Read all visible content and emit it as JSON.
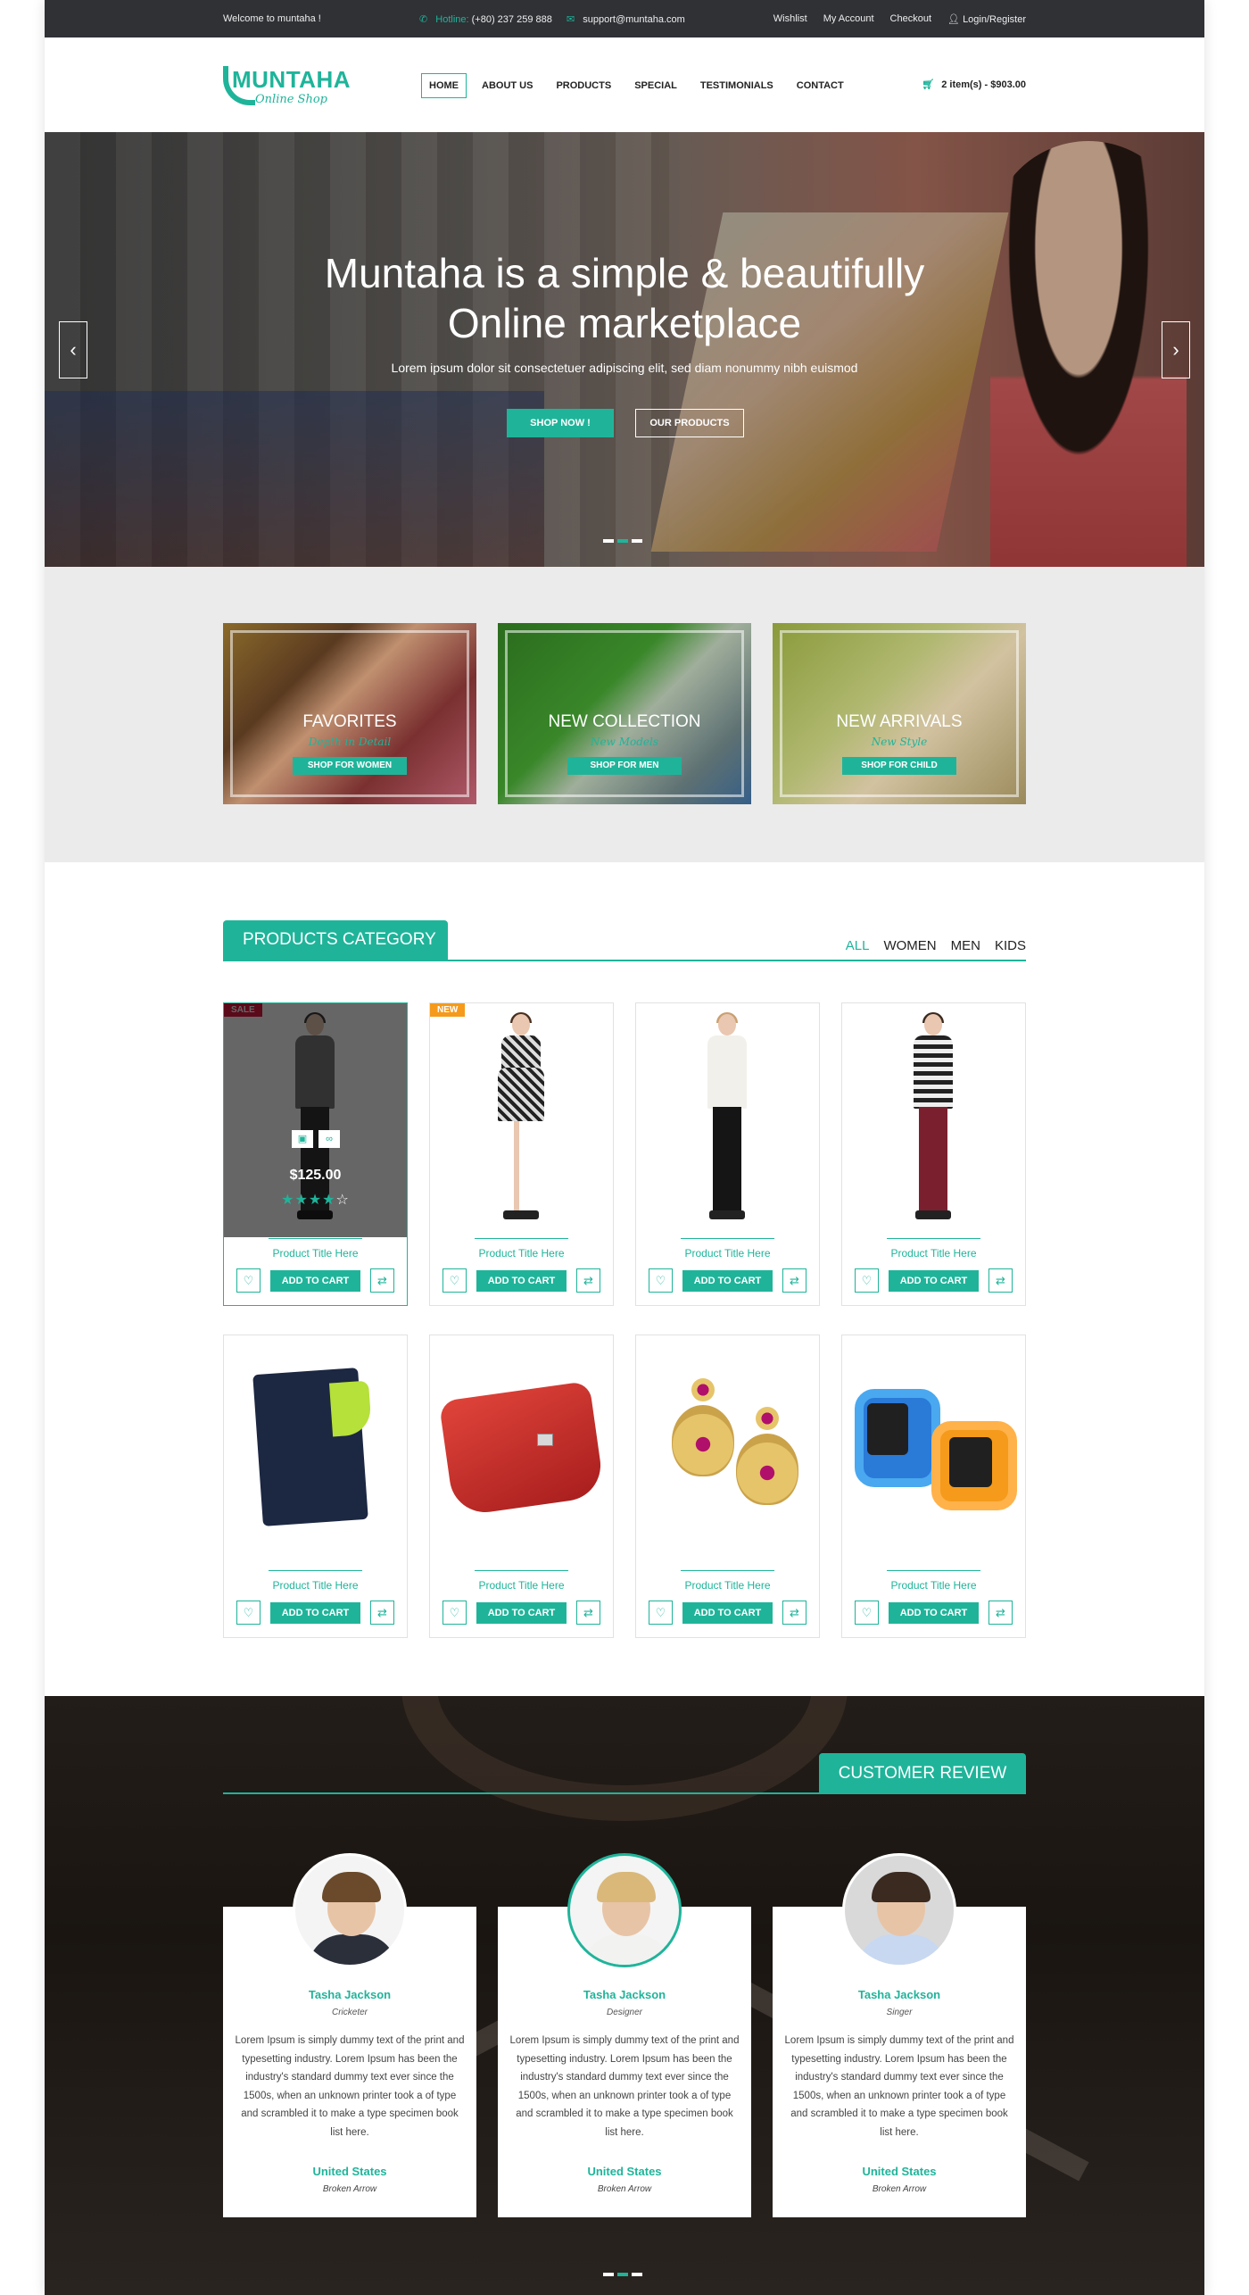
{
  "topbar": {
    "welcome": "Welcome to muntaha !",
    "hotline_label": "Hotline:",
    "hotline_number": "(+80) 237 259 888",
    "email": "support@muntaha.com",
    "links": [
      "Wishlist",
      "My Account",
      "Checkout",
      "Login/Register"
    ]
  },
  "header": {
    "logo_name": "MUNTAHA",
    "logo_tagline": "Online Shop",
    "nav": [
      "HOME",
      "ABOUT US",
      "PRODUCTS",
      "SPECIAL",
      "TESTIMONIALS",
      "CONTACT"
    ],
    "active_nav": "HOME",
    "cart_text": "2 item(s) - $903.00"
  },
  "hero": {
    "title_line1": "Muntaha is a simple & beautifully",
    "title_line2": "Online marketplace",
    "subtitle": "Lorem ipsum dolor sit consectetuer adipiscing elit, sed diam nonummy nibh euismod",
    "primary_button": "SHOP NOW !",
    "secondary_button": "OUR PRODUCTS",
    "prev_glyph": "‹",
    "next_glyph": "›",
    "slide_count": 3,
    "active_slide": 2
  },
  "features": [
    {
      "title": "FAVORITES",
      "subtitle": "Depth in Detail",
      "button": "SHOP FOR WOMEN"
    },
    {
      "title": "NEW COLLECTION",
      "subtitle": "New Models",
      "button": "SHOP FOR MEN"
    },
    {
      "title": "NEW ARRIVALS",
      "subtitle": "New Style",
      "button": "SHOP FOR CHILD"
    }
  ],
  "products": {
    "heading": "PRODUCTS CATEGORY",
    "filters": [
      "ALL",
      "WOMEN",
      "MEN",
      "KIDS"
    ],
    "active_filter": "ALL",
    "add_to_cart": "ADD TO CART",
    "items": [
      {
        "title": "Product Title Here",
        "badge": "SALE",
        "price": "$125.00",
        "rating": 4,
        "image": "man-grey-sweater"
      },
      {
        "title": "Product Title Here",
        "badge": "NEW",
        "image": "woman-patterned-dress"
      },
      {
        "title": "Product Title Here",
        "badge": "",
        "image": "woman-white-top-black-pants"
      },
      {
        "title": "Product Title Here",
        "badge": "",
        "image": "man-striped-sweater"
      },
      {
        "title": "Product Title Here",
        "badge": "",
        "image": "phone-flip-case"
      },
      {
        "title": "Product Title Here",
        "badge": "",
        "image": "red-wallet"
      },
      {
        "title": "Product Title Here",
        "badge": "",
        "image": "gold-earrings"
      },
      {
        "title": "Product Title Here",
        "badge": "",
        "image": "kids-smartwatches"
      }
    ]
  },
  "reviews": {
    "heading": "CUSTOMER REVIEW",
    "items": [
      {
        "name": "Tasha Jackson",
        "role": "Cricketer",
        "text": "Lorem Ipsum is simply dummy text of the print and typesetting industry. Lorem Ipsum has been the industry's standard dummy text ever since the 1500s, when an unknown printer took a of type and scrambled it to make a type specimen book list here.",
        "country": "United States",
        "sub": "Broken Arrow"
      },
      {
        "name": "Tasha Jackson",
        "role": "Designer",
        "text": "Lorem Ipsum is simply dummy text of the print and typesetting industry. Lorem Ipsum has been the industry's standard dummy text ever since the 1500s, when an unknown printer took a of type and scrambled it to make a type specimen book list here.",
        "country": "United States",
        "sub": "Broken Arrow"
      },
      {
        "name": "Tasha Jackson",
        "role": "Singer",
        "text": "Lorem Ipsum is simply dummy text of the print and typesetting industry. Lorem Ipsum has been the industry's standard dummy text ever since the 1500s, when an unknown printer took a of type and scrambled it to make a type specimen book list here.",
        "country": "United States",
        "sub": "Broken Arrow"
      }
    ],
    "slide_count": 3,
    "active_slide": 2
  },
  "icons": {
    "hotline": "phone-icon",
    "email": "envelope-icon",
    "login": "user-icon",
    "cart": "cart-icon",
    "wishlist": "heart-icon",
    "compare": "exchange-icon",
    "quick_view": "image-icon",
    "link": "link-icon"
  },
  "colors": {
    "accent": "#1fb49a",
    "topbar": "#2f3135",
    "sale": "#e0193f",
    "new": "#f59a1b"
  }
}
